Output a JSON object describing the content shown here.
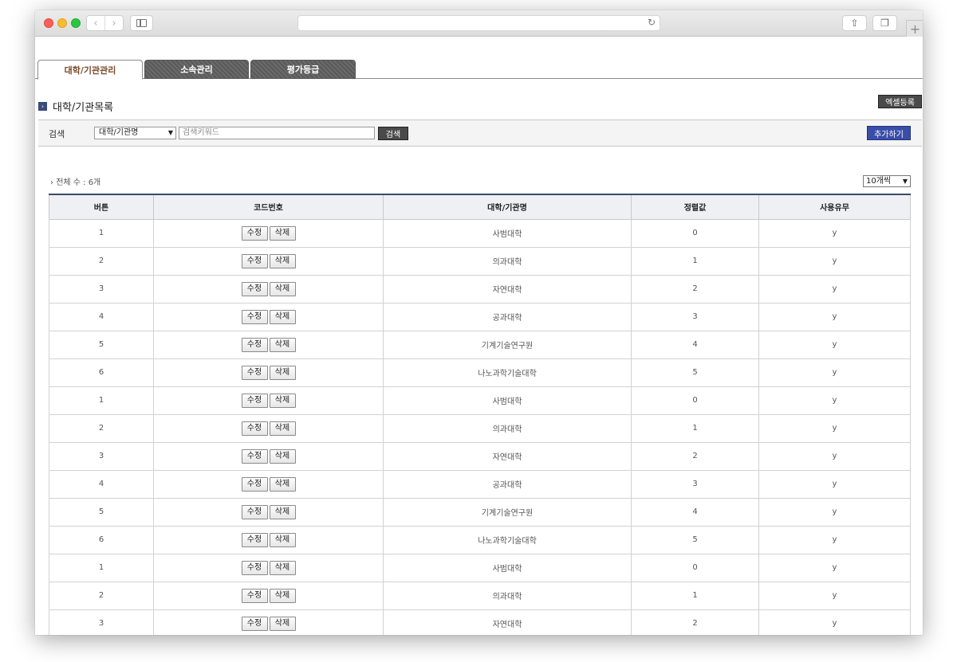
{
  "tabs": [
    {
      "label": "대학/기관관리"
    },
    {
      "label": "소속관리"
    },
    {
      "label": "평가등급"
    }
  ],
  "section": {
    "title": "대학/기관목록"
  },
  "buttons": {
    "excel": "엑셀등록",
    "search": "검색",
    "add": "추가하기",
    "edit": "수정",
    "delete": "삭제"
  },
  "search": {
    "label": "검색",
    "select_value": "대학/기관명",
    "placeholder": "검색키워드"
  },
  "list": {
    "total": "전체 수 : 6개",
    "page_size": "10개씩"
  },
  "table": {
    "headers": [
      "버튼",
      "코드번호",
      "대학/기관명",
      "정렬값",
      "사용유무"
    ],
    "rows": [
      {
        "num": "1",
        "name": "사범대학",
        "sort": "0",
        "use": "y"
      },
      {
        "num": "2",
        "name": "의과대학",
        "sort": "1",
        "use": "y"
      },
      {
        "num": "3",
        "name": "자연대학",
        "sort": "2",
        "use": "y"
      },
      {
        "num": "4",
        "name": "공과대학",
        "sort": "3",
        "use": "y"
      },
      {
        "num": "5",
        "name": "기계기술연구원",
        "sort": "4",
        "use": "y"
      },
      {
        "num": "6",
        "name": "나노과학기술대학",
        "sort": "5",
        "use": "y"
      },
      {
        "num": "1",
        "name": "사범대학",
        "sort": "0",
        "use": "y"
      },
      {
        "num": "2",
        "name": "의과대학",
        "sort": "1",
        "use": "y"
      },
      {
        "num": "3",
        "name": "자연대학",
        "sort": "2",
        "use": "y"
      },
      {
        "num": "4",
        "name": "공과대학",
        "sort": "3",
        "use": "y"
      },
      {
        "num": "5",
        "name": "기계기술연구원",
        "sort": "4",
        "use": "y"
      },
      {
        "num": "6",
        "name": "나노과학기술대학",
        "sort": "5",
        "use": "y"
      },
      {
        "num": "1",
        "name": "사범대학",
        "sort": "0",
        "use": "y"
      },
      {
        "num": "2",
        "name": "의과대학",
        "sort": "1",
        "use": "y"
      },
      {
        "num": "3",
        "name": "자연대학",
        "sort": "2",
        "use": "y"
      }
    ]
  },
  "colors": {
    "accent": "#3a4ea8",
    "dark_button": "#4a4a4a",
    "active_tab_text": "#7a4a2a"
  }
}
